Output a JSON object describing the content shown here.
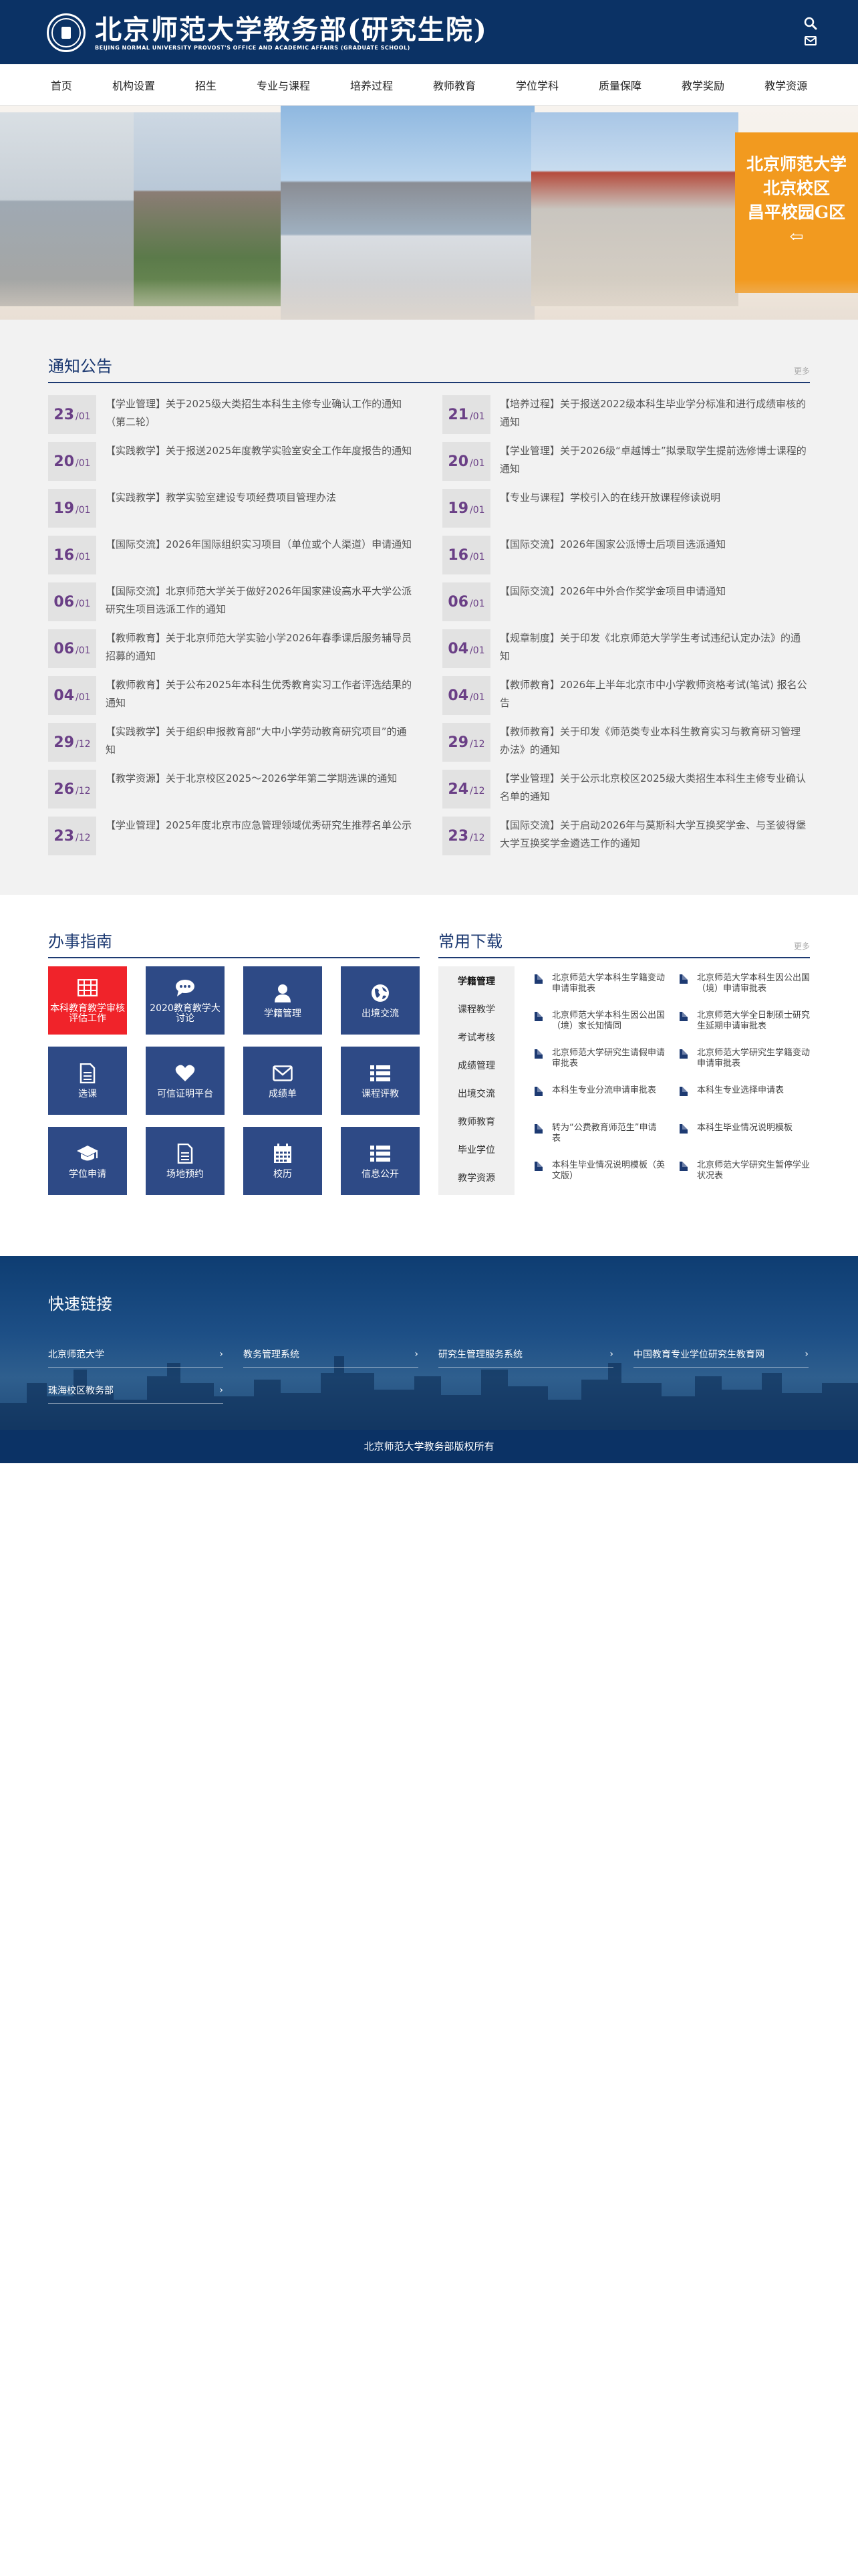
{
  "header": {
    "logo_cn": "北京师范大学教务部(研究生院)",
    "logo_en": "BEIJING NORMAL UNIVERSITY  PROVOST'S OFFICE AND ACADEMIC AFFAIRS (GRADUATE SCHOOL)",
    "icons": [
      "search-icon",
      "mail-icon"
    ]
  },
  "nav": [
    "首页",
    "机构设置",
    "招生",
    "专业与课程",
    "培养过程",
    "教师教育",
    "学位学科",
    "质量保障",
    "教学奖励",
    "教学资源"
  ],
  "banner": {
    "line1": "北京师范大学",
    "line2": "北京校区",
    "line3": "昌平校园G区",
    "arrow": "⇦"
  },
  "notices": {
    "title": "通知公告",
    "more": "更多",
    "left": [
      {
        "day": "23",
        "month": "/01",
        "text": "【学业管理】关于2025级大类招生本科生主修专业确认工作的通知（第二轮）"
      },
      {
        "day": "20",
        "month": "/01",
        "text": "【实践教学】关于报送2025年度教学实验室安全工作年度报告的通知"
      },
      {
        "day": "19",
        "month": "/01",
        "text": "【实践教学】教学实验室建设专项经费项目管理办法"
      },
      {
        "day": "16",
        "month": "/01",
        "text": "【国际交流】2026年国际组织实习项目（单位或个人渠道）申请通知"
      },
      {
        "day": "06",
        "month": "/01",
        "text": "【国际交流】北京师范大学关于做好2026年国家建设高水平大学公派研究生项目选派工作的通知"
      },
      {
        "day": "06",
        "month": "/01",
        "text": "【教师教育】关于北京师范大学实验小学2026年春季课后服务辅导员招募的通知"
      },
      {
        "day": "04",
        "month": "/01",
        "text": "【教师教育】关于公布2025年本科生优秀教育实习工作者评选结果的通知"
      },
      {
        "day": "29",
        "month": "/12",
        "text": "【实践教学】关于组织申报教育部“大中小学劳动教育研究项目”的通知"
      },
      {
        "day": "26",
        "month": "/12",
        "text": "【教学资源】关于北京校区2025～2026学年第二学期选课的通知"
      },
      {
        "day": "23",
        "month": "/12",
        "text": "【学业管理】2025年度北京市应急管理领域优秀研究生推荐名单公示"
      }
    ],
    "right": [
      {
        "day": "21",
        "month": "/01",
        "text": "【培养过程】关于报送2022级本科生毕业学分标准和进行成绩审核的通知"
      },
      {
        "day": "20",
        "month": "/01",
        "text": "【学业管理】关于2026级“卓越博士”拟录取学生提前选修博士课程的通知"
      },
      {
        "day": "19",
        "month": "/01",
        "text": "【专业与课程】学校引入的在线开放课程修读说明"
      },
      {
        "day": "16",
        "month": "/01",
        "text": "【国际交流】2026年国家公派博士后项目选派通知"
      },
      {
        "day": "06",
        "month": "/01",
        "text": "【国际交流】2026年中外合作奖学金项目申请通知"
      },
      {
        "day": "04",
        "month": "/01",
        "text": "【规章制度】关于印发《北京师范大学学生考试违纪认定办法》的通知"
      },
      {
        "day": "04",
        "month": "/01",
        "text": "【教师教育】2026年上半年北京市中小学教师资格考试(笔试) 报名公告"
      },
      {
        "day": "29",
        "month": "/12",
        "text": "【教师教育】关于印发《师范类专业本科生教育实习与教育研习管理办法》的通知"
      },
      {
        "day": "24",
        "month": "/12",
        "text": "【学业管理】关于公示北京校区2025级大类招生本科生主修专业确认名单的通知"
      },
      {
        "day": "23",
        "month": "/12",
        "text": "【国际交流】关于启动2026年与莫斯科大学互换奖学金、与圣彼得堡大学互换奖学金遴选工作的通知"
      }
    ]
  },
  "guide": {
    "title": "办事指南",
    "tiles": [
      {
        "label": "本科教育教学审核评估工作",
        "icon": "grid-icon",
        "highlight": true
      },
      {
        "label": "2020教育教学大讨论",
        "icon": "chat-icon"
      },
      {
        "label": "学籍管理",
        "icon": "user-icon"
      },
      {
        "label": "出境交流",
        "icon": "globe-icon"
      },
      {
        "label": "选课",
        "icon": "document-icon"
      },
      {
        "label": "可信证明平台",
        "icon": "heart-icon"
      },
      {
        "label": "成绩单",
        "icon": "envelope-icon"
      },
      {
        "label": "课程评教",
        "icon": "list-icon"
      },
      {
        "label": "学位申请",
        "icon": "graduation-cap-icon"
      },
      {
        "label": "场地预约",
        "icon": "document-icon"
      },
      {
        "label": "校历",
        "icon": "calendar-icon"
      },
      {
        "label": "信息公开",
        "icon": "list-icon"
      }
    ]
  },
  "downloads": {
    "title": "常用下载",
    "more": "更多",
    "tabs": [
      "学籍管理",
      "课程教学",
      "考试考核",
      "成绩管理",
      "出境交流",
      "教师教育",
      "毕业学位",
      "教学资源"
    ],
    "active_tab": "学籍管理",
    "items": [
      "北京师范大学本科生学籍变动申请审批表",
      "北京师范大学本科生因公出国（境）申请审批表",
      "北京师范大学本科生因公出国（境）家长知情同",
      "北京师范大学全日制硕士研究生延期申请审批表",
      "北京师范大学研究生请假申请审批表",
      "北京师范大学研究生学籍变动申请审批表",
      "本科生专业分流申请审批表",
      "本科生专业选择申请表",
      "转为“公费教育师范生”申请表",
      "本科生毕业情况说明模板",
      "本科生毕业情况说明模板（英文版）",
      "北京师范大学研究生暂停学业状况表"
    ]
  },
  "quick_links": {
    "title": "快速链接",
    "items": [
      "北京师范大学",
      "教务管理系统",
      "研究生管理服务系统",
      "中国教育专业学位研究生教育网",
      "珠海校区教务部"
    ],
    "chevron": "›"
  },
  "footer": {
    "text": "北京师范大学教务部版权所有"
  }
}
